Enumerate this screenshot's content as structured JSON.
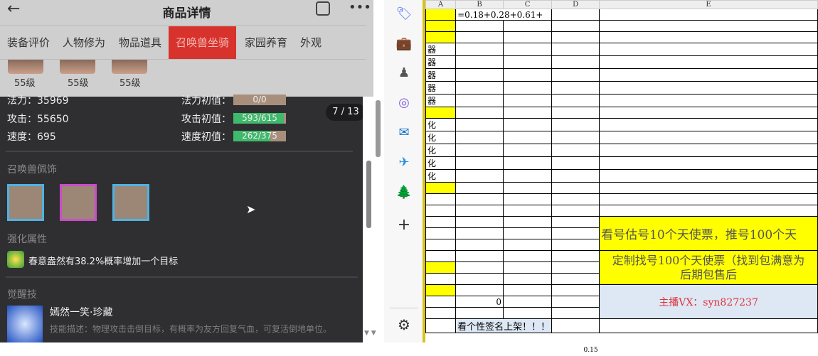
{
  "phone": {
    "title": "商品详情",
    "tabs": [
      "装备评价",
      "人物修为",
      "物品道具",
      "召唤兽坐骑",
      "家园养育",
      "外观"
    ],
    "active_tab": 3,
    "levels": [
      "55级",
      "55级",
      "55级"
    ],
    "stats": [
      {
        "label": "法力：35969",
        "init_label": "法力初值：",
        "init": "0/0",
        "fill": 0
      },
      {
        "label": "攻击：55650",
        "init_label": "攻击初值：",
        "init": "593/615",
        "fill": 0.96
      },
      {
        "label": "速度：695",
        "init_label": "速度初值：",
        "init": "262/375",
        "fill": 0.7
      }
    ],
    "page_badge": "7 / 13",
    "ornament_title": "召唤兽佩饰",
    "enhance_title": "强化属性",
    "enhance_text": "春意盎然有38.2%概率增加一个目标",
    "awaken_title": "觉醒技",
    "skill_name": "嫣然一笑·珍藏",
    "skill_desc": "技能描述：物理攻击击倒目标，有概率为友方回复气血，可复活倒地单位。"
  },
  "sheet": {
    "cols": [
      "A",
      "B",
      "C",
      "D",
      "E"
    ],
    "formula": "=0.18+0.28+0.61+",
    "a_texts": [
      "器",
      "器",
      "器",
      "器",
      "器",
      "化",
      "化",
      "化",
      "化",
      "化"
    ],
    "zero": "0",
    "signature": "看个性签名上架！！！",
    "ad1": "看号估号10个天使票，推号100个天",
    "ad2a": "定制找号100个天使票（找到包满意为",
    "ad2b": "后期包售后",
    "contact": "主播VX：syn827237",
    "footer_value": "0.15"
  }
}
